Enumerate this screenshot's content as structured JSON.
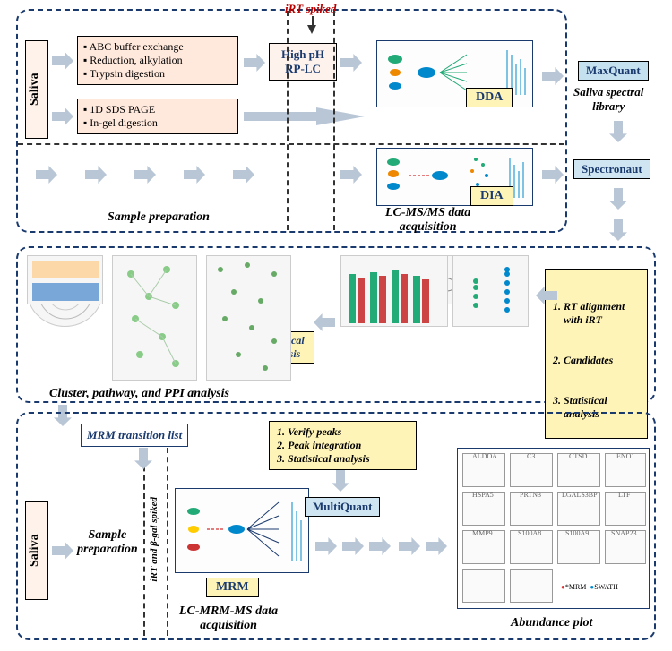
{
  "topPanel": {
    "saliva": "Saliva",
    "irt_spiked": "iRT spiked",
    "prep1": {
      "items": [
        "ABC buffer exchange",
        "Reduction, alkylation",
        "Trypsin digestion"
      ]
    },
    "prep2": {
      "items": [
        "1D SDS PAGE",
        "In-gel digestion"
      ]
    },
    "hplc": "High pH\nRP-LC",
    "dda": "DDA",
    "dia": "DIA",
    "section_prep": "Sample preparation",
    "section_acq": "LC-MS/MS data\nacquisition"
  },
  "rightCol": {
    "maxquant": "MaxQuant",
    "library": "Saliva spectral\nlibrary",
    "spectronaut": "Spectronaut"
  },
  "midPanel": {
    "cluster": "Cluster, pathway, and PPI analysis",
    "stat": "Statistical\nanalysis",
    "steps": {
      "s1": "1. RT alignment\n    with iRT",
      "s2": "2. Candidates",
      "s3": "3. Statistical\n    analysis"
    }
  },
  "botPanel": {
    "mrm_list": "MRM transition list",
    "saliva": "Saliva",
    "sample_prep": "Sample\npreparation",
    "irt_bgal": "iRT and β-gal spiked",
    "mrm": "MRM",
    "acq": "LC-MRM-MS data\nacquisition",
    "multiquant": "MultiQuant",
    "verify": {
      "s1": "1. Verify peaks",
      "s2": "2. Peak integration",
      "s3": "3. Statistical analysis"
    },
    "abundance": "Abundance plot",
    "plot_labels": [
      "ALDOA",
      "C3",
      "CTSD",
      "ENO1",
      "HSPA5",
      "PRTN3",
      "LGALS3BP",
      "LTF",
      "MMP9",
      "S100A8",
      "S100A9",
      "SNAP23"
    ],
    "legend_mrm": "*MRM",
    "legend_swath": "SWATH"
  }
}
